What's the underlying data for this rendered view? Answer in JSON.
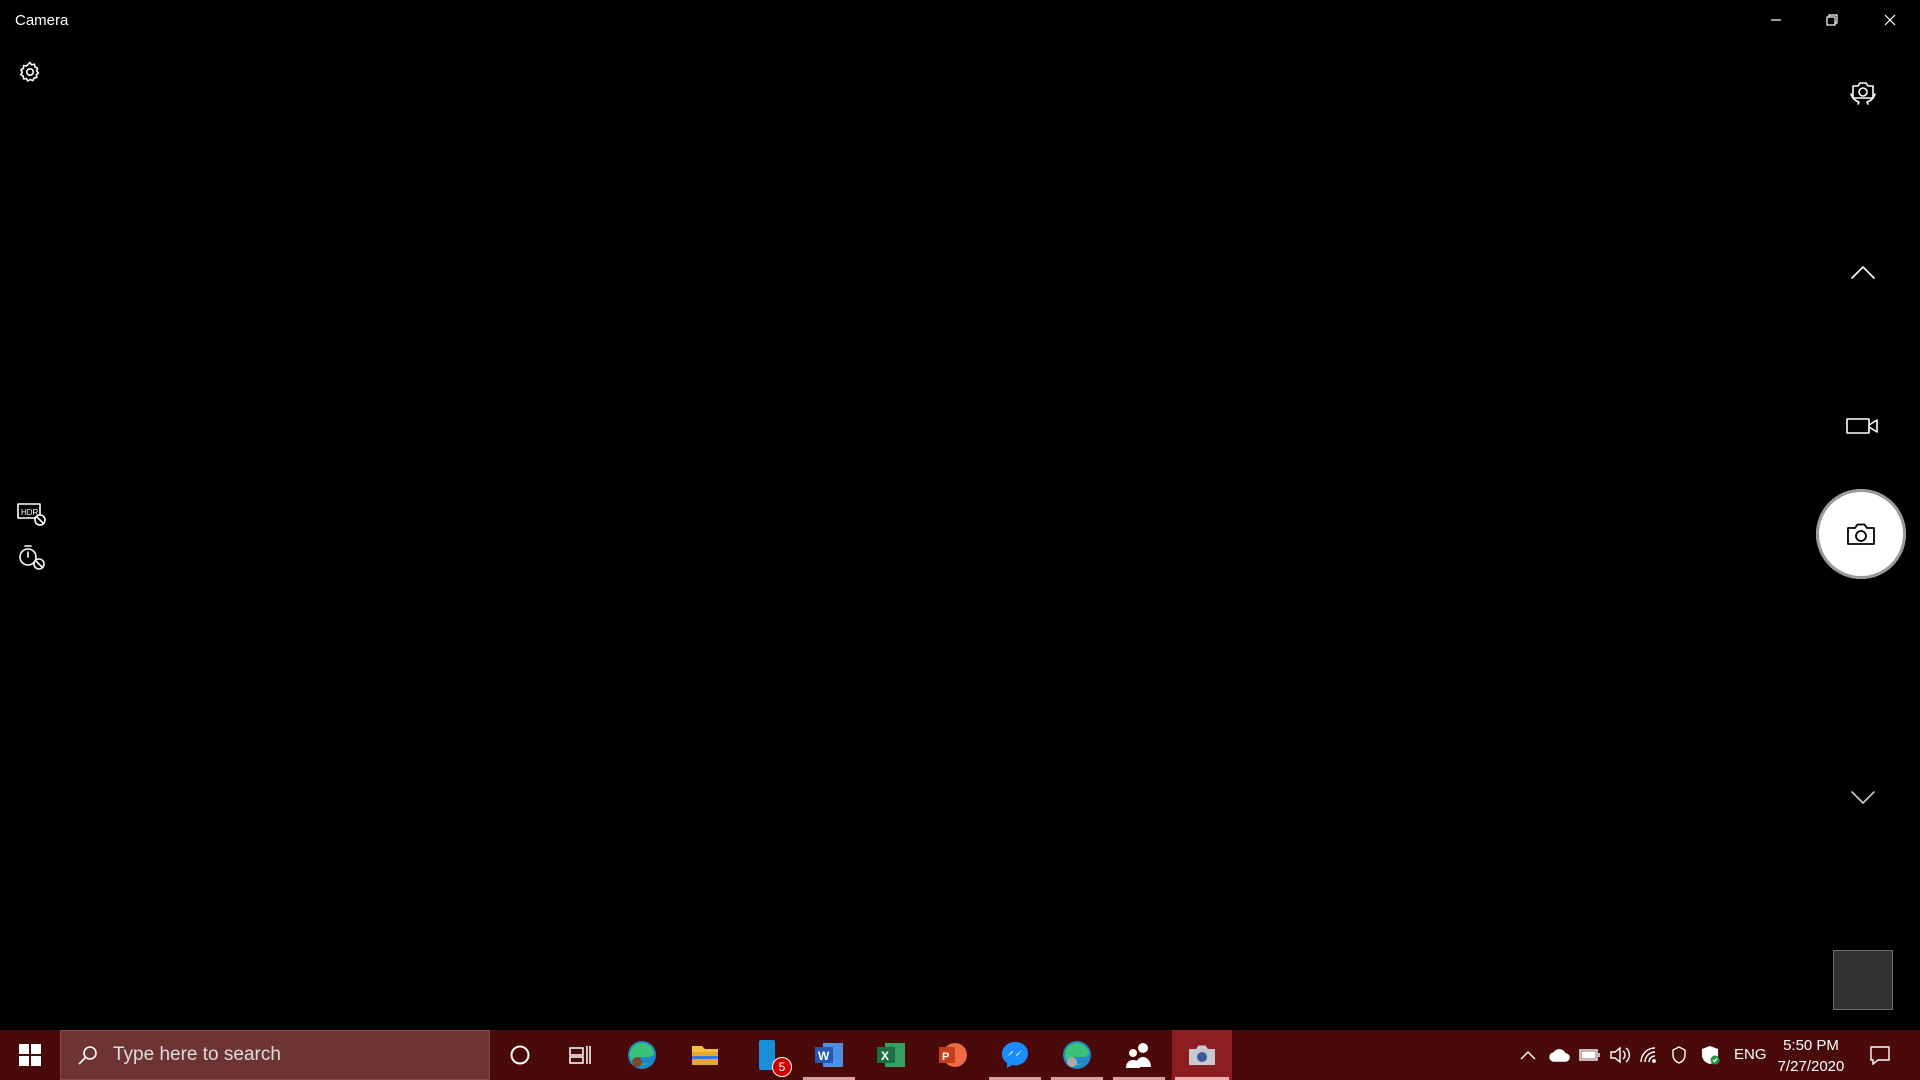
{
  "window": {
    "title": "Camera"
  },
  "camera": {
    "controls": [
      "settings-icon",
      "switch-camera-icon",
      "chevron-up-icon",
      "video-mode-icon",
      "photo-shutter",
      "chevron-down-icon"
    ],
    "left_toggles": [
      "hdr-off-icon",
      "timer-off-icon"
    ]
  },
  "taskbar": {
    "search_placeholder": "Type here to search",
    "apps": [
      "cortana",
      "task-view",
      "edge",
      "file-explorer",
      "phone",
      "word",
      "excel",
      "powerpoint",
      "messenger",
      "edge-beta",
      "people",
      "camera"
    ],
    "phone_badge": "5",
    "language": "ENG",
    "time": "5:50 PM",
    "date": "7/27/2020"
  },
  "colors": {
    "taskbar": "#4a0a0a",
    "search": "#6e3434",
    "active_app": "#8c1e22"
  }
}
